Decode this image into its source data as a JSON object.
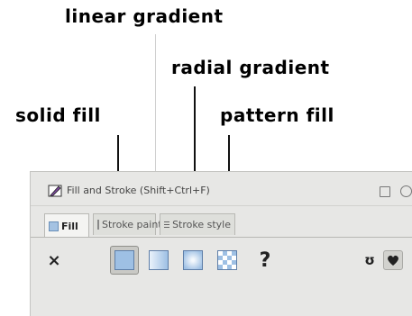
{
  "annotations": {
    "linear_gradient": "linear gradient",
    "radial_gradient": "radial gradient",
    "solid_fill": "solid fill",
    "pattern_fill": "pattern fill"
  },
  "dialog": {
    "title": "Fill and Stroke (Shift+Ctrl+F)",
    "tabs": [
      {
        "label": "Fill",
        "active": true,
        "icon": "fill-swatch-icon"
      },
      {
        "label": "Stroke paint",
        "active": false,
        "icon": "stroke-swatch-icon"
      },
      {
        "label": "Stroke style",
        "active": false,
        "icon": "stroke-style-icon"
      }
    ],
    "fill_buttons": {
      "none": "×",
      "unset": "?",
      "evenodd": "ʊ",
      "selected": "flat"
    },
    "colors": {
      "swatch_blue": "#9ec0e4",
      "dialog_bg": "#e7e7e5"
    }
  }
}
